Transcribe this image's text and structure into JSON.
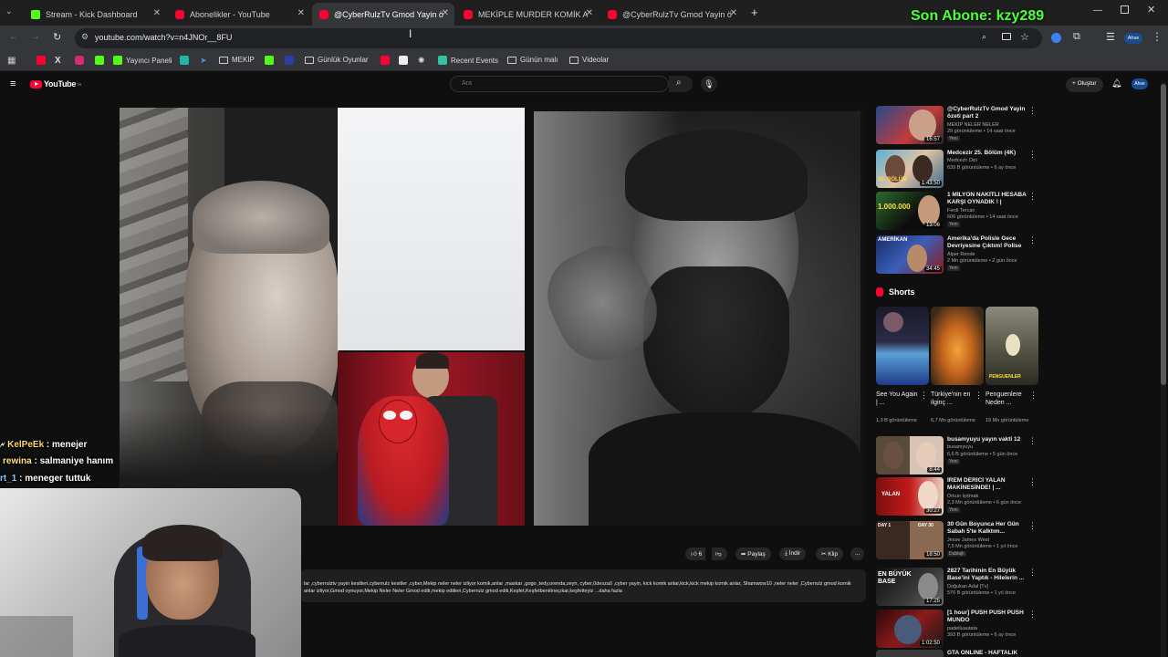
{
  "browser": {
    "tabs": [
      {
        "title": "Stream - Kick Dashboard",
        "icon": "kick-icon",
        "active": false
      },
      {
        "title": "Abonelikler - YouTube",
        "icon": "youtube-icon",
        "active": false
      },
      {
        "title": "@CyberRulzTv Gmod Yayin öze",
        "icon": "youtube-icon",
        "active": true
      },
      {
        "title": "MEKİPLE MURDER KOMİK ANL",
        "icon": "youtube-icon",
        "active": false
      },
      {
        "title": "@CyberRulzTv Gmod Yayin öze",
        "icon": "youtube-icon",
        "active": false
      }
    ],
    "new_tab": "+",
    "url": "youtube.com/watch?v=n4JNOr__8FU",
    "bookmarks": [
      {
        "label": "Yayıncı Paneli",
        "icon": "kick-icon"
      },
      {
        "label": "MEKİP",
        "icon": "folder-icon"
      },
      {
        "label": "Günlük Oyunlar",
        "icon": "folder-icon"
      },
      {
        "label": "Recent Events",
        "icon": "streamlabs-icon"
      },
      {
        "label": "Günün malı",
        "icon": "folder-icon"
      },
      {
        "label": "Videolar",
        "icon": "folder-icon"
      }
    ],
    "profile_label": "Ahse"
  },
  "overlay": {
    "sub_banner": "Son Abone: kzy289",
    "chat": [
      {
        "user": "KelPeEk",
        "message": ": menejer"
      },
      {
        "user": "rewina",
        "message": ": salmaniye hanım"
      },
      {
        "user": "rt_1",
        "message": ": meneger tuttuk"
      }
    ]
  },
  "youtube": {
    "logo": "YouTube",
    "logo_sup": "TR",
    "search_placeholder": "Ara",
    "create_label": "Oluştur",
    "actions": {
      "like_count": "6",
      "share": "Paylaş",
      "download": "İndir",
      "clip": "Klip",
      "more": "..."
    },
    "description": "lar ,cyberrulztv yayin kesitleri,cyberrulz kesitler ,cyber,Mekip neler neler izliyor komik,anlar ,maskar ,gogo ,tedy,orenda,zeyn, cyber,0desza0 ,cyber yayin, kick komik anlar,kick,kick mekip komik anlar, Shamwow10 ,neler neler ,Cyberrulz gmod komik anlar izliyor,Gmod oynuyor,Mekip Neler Neler Gmod editi,mekip editleri,Cyberrulz gmod editi,Keşfet,Keşfetbeniöneçıkar,keşfetteyiz ...daha fazla",
    "recommended": [
      {
        "title": "@CyberRulzTv Gmod Yayin özeti part 2",
        "channel": "MEKİP NELER NELER",
        "meta": "29 görüntüleme • 14 saat önce",
        "badge": "Yeni",
        "duration": "16:57"
      },
      {
        "title": "Medcezir 25. Bölüm (4K)",
        "channel": "Medcezir Dizi",
        "meta": "639 B görüntüleme • 6 ay önce",
        "badge": "",
        "duration": "1:43:50"
      },
      {
        "title": "1 MİLYON NAKİTLİ HESABA KARŞI OYNADIK ! | #wolfteam",
        "channel": "Ferdi Tercan",
        "meta": "606 görüntüleme • 14 saat önce",
        "badge": "Yeni",
        "duration": "13:06"
      },
      {
        "title": "Amerika'da Polisle Gece Devriyesine Çıktım! Polise Küf...",
        "channel": "Alper Rende",
        "meta": "2 Mn görüntüleme • 2 gün önce",
        "badge": "Yeni",
        "duration": "34:45"
      },
      {
        "title": "busamyuyu yayın vakti 12",
        "channel": "busamyuyu",
        "meta": "6,6 B görüntüleme • 5 gün önce",
        "badge": "Yeni",
        "duration": "8:44"
      },
      {
        "title": "İREM DERİCİ YALAN MAKİNESİNDE! | ...",
        "channel": "Orkun Işıtmak",
        "meta": "2,3 Mn görüntüleme • 6 gün önce",
        "badge": "Yeni",
        "duration": "30:27"
      },
      {
        "title": "30 Gün Boyunca Her Gün Sabah 5'te Kalktım...",
        "channel": "Jesse James West",
        "meta": "7,5 Mn görüntüleme • 1 yıl önce",
        "badge": "Dublajlı",
        "duration": "18:50"
      },
      {
        "title": "2827 Tarihinin En Büyük Base'ini Yaptık - Hilelerin ...",
        "channel": "Doğukan Adal [Tv]",
        "meta": "576 B görüntüleme • 1 yıl önce",
        "badge": "",
        "duration": "17:25"
      },
      {
        "title": "[1 hour] PUSH PUSH PUSH MUNDO",
        "channel": "padelluautata",
        "meta": "393 B görüntüleme • 6 ay önce",
        "badge": "",
        "duration": "1:02:50"
      },
      {
        "title": "GTA ONLINE - HAFTALIK",
        "channel": "",
        "meta": "",
        "badge": "",
        "duration": ""
      }
    ],
    "thumb_text": {
      "rec2": "25. BÖLÜM",
      "rec3": "1.000.000",
      "rec4": "AMERİKAN",
      "rec6": "YALAN",
      "rec7_left": "DAY 1",
      "rec7_right": "DAY 30",
      "rec8": "EN BÜYÜK BASE"
    },
    "shorts_title": "Shorts",
    "shorts": [
      {
        "title": "See You Again | ...",
        "views": "1,3 B görüntüleme"
      },
      {
        "title": "Türkiye'nin en ilginç ...",
        "views": "6,7 Mn görüntüleme"
      },
      {
        "title": "Penguenlere Neden ...",
        "views": "19 Mn görüntüleme",
        "thumb_text": "PENGUENLER"
      }
    ]
  }
}
